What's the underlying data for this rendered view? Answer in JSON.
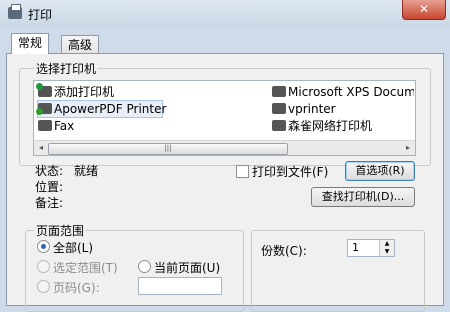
{
  "window": {
    "title": "打印",
    "close": "✕"
  },
  "tabs": [
    "常规",
    "高级"
  ],
  "select_printer": {
    "title": "选择打印机",
    "printers": [
      {
        "name": "添加打印机",
        "icon": "add-printer-icon"
      },
      {
        "name": "ApowerPDF Printer",
        "icon": "printer-default-icon"
      },
      {
        "name": "Fax",
        "icon": "fax-icon"
      },
      {
        "name": "Microsoft XPS Docume",
        "icon": "printer-icon"
      },
      {
        "name": "vprinter",
        "icon": "printer-icon"
      },
      {
        "name": "森雀网络打印机",
        "icon": "network-printer-icon"
      }
    ],
    "scroll_left": "◂",
    "scroll_thumb": "|||",
    "scroll_right": "▸"
  },
  "status": {
    "status_label": "状态:",
    "status_value": "就绪",
    "location_label": "位置:",
    "comment_label": "备注:",
    "print_to_file": "打印到文件(F)",
    "preferences_button": "首选项(R)",
    "find_printer_button": "查找打印机(D)..."
  },
  "page_range": {
    "title": "页面范围",
    "all": "全部(L)",
    "selection": "选定范围(T)",
    "current_page": "当前页面(U)",
    "pages": "页码(G):",
    "pages_value": ""
  },
  "copies": {
    "label": "份数(C):",
    "value": "1"
  }
}
